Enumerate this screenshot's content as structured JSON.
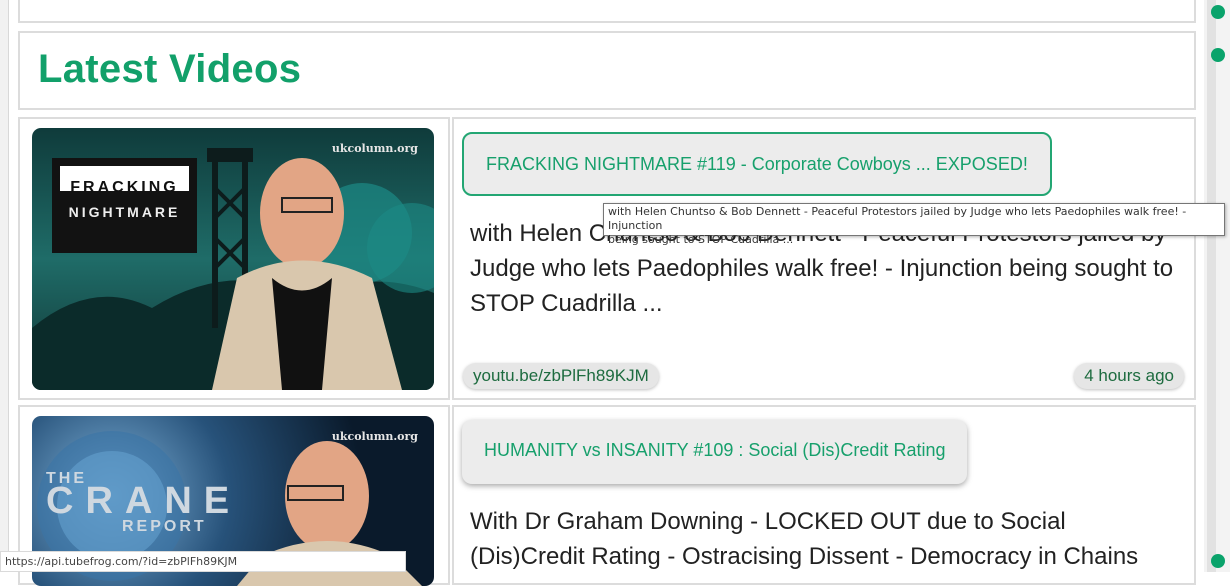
{
  "header": {
    "title": "Latest Videos"
  },
  "colors": {
    "accent": "#12a06a",
    "scrollbar_dot": "#0aa36b"
  },
  "videos": [
    {
      "thumbnail": {
        "site_label": "ukcolumn.org",
        "logo_line1": "FRACKING",
        "logo_line2": "NIGHTMARE"
      },
      "title": "FRACKING NIGHTMARE #119 - Corporate Cowboys ... EXPOSED!",
      "description": "with Helen Chuntso & Bob Dennett - Peaceful Protestors jailed by Judge who lets Paedophiles walk free! - Injunction being sought to STOP Cuadrilla ...",
      "link": "youtu.be/zbPlFh89KJM",
      "time": "4 hours ago"
    },
    {
      "thumbnail": {
        "site_label": "ukcolumn.org",
        "logo_line1": "THE",
        "logo_line2": "CRANE",
        "logo_line3": "REPORT"
      },
      "title": "HUMANITY vs INSANITY #109 : Social (Dis)Credit Rating",
      "description": "With Dr Graham Downing - LOCKED OUT due to Social (Dis)Credit Rating - Ostracising Dissent - Democracy in Chains"
    }
  ],
  "tooltip": {
    "line1": "with Helen Chuntso & Bob Dennett - Peaceful Protestors jailed by Judge who lets Paedophiles walk free! - Injunction",
    "line2": "being sought to STOP Cuadrilla ..."
  },
  "status_bar": {
    "url": "https://api.tubefrog.com/?id=zbPlFh89KJM"
  }
}
